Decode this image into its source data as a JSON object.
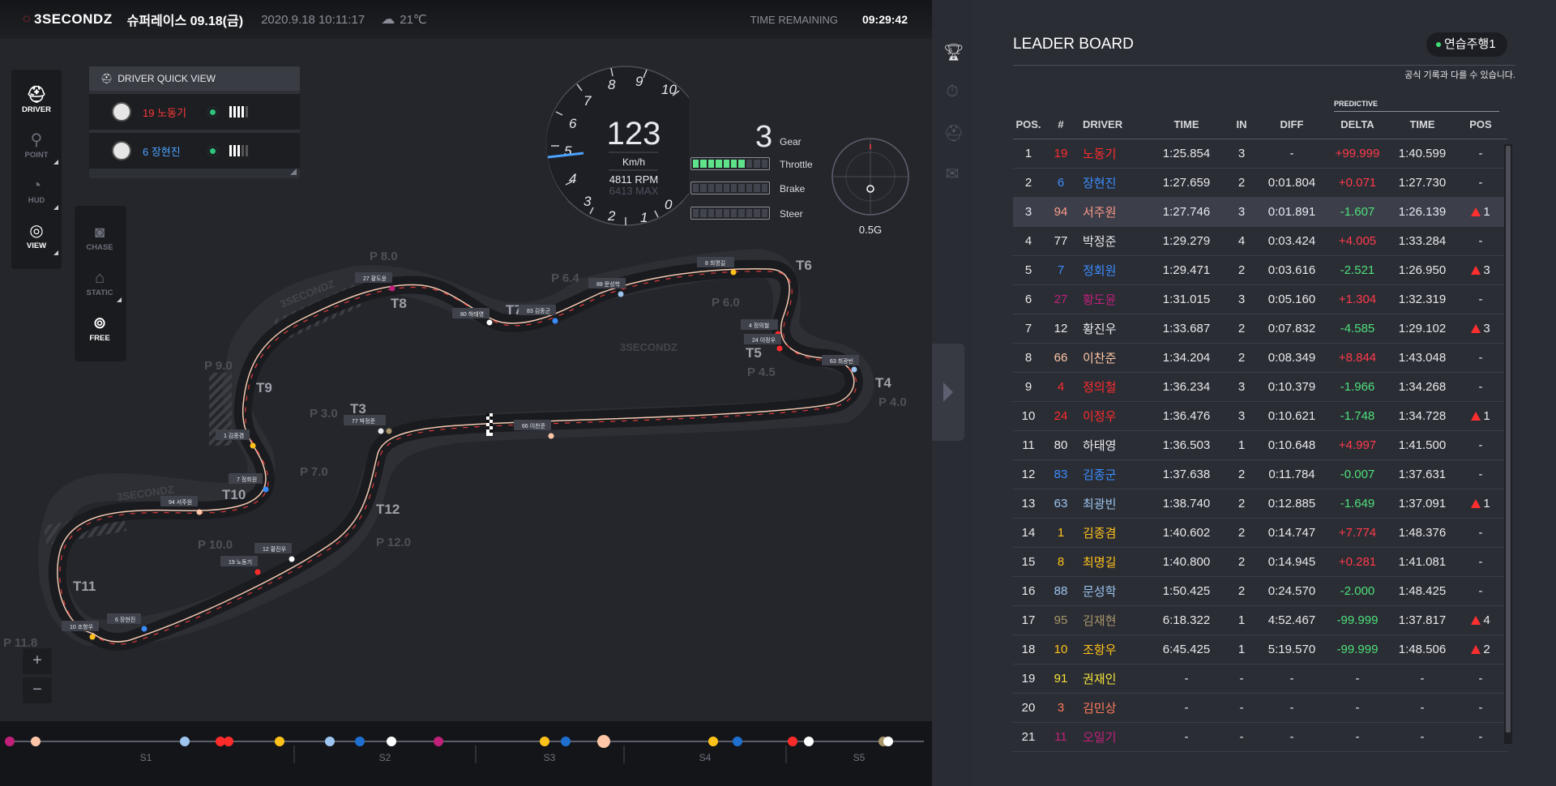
{
  "topbar": {
    "logo": "3SECONDZ",
    "race_title": "슈퍼레이스 09.18(금)",
    "datetime": "2020.9.18 10:11:17",
    "temperature": "21℃",
    "time_remaining_label": "TIME REMAINING",
    "time_remaining_value": "09:29:42"
  },
  "tools_left": [
    {
      "label": "DRIVER",
      "icon": "helmet-icon",
      "active": true
    },
    {
      "label": "POINT",
      "icon": "point-icon",
      "active": false
    },
    {
      "label": "HUD",
      "icon": "gauge-icon",
      "active": false
    },
    {
      "label": "VIEW",
      "icon": "target-icon",
      "active": true
    }
  ],
  "tools_camera": [
    {
      "label": "CHASE",
      "icon": "camera-icon"
    },
    {
      "label": "STATIC",
      "icon": "cctv-icon"
    },
    {
      "label": "FREE",
      "icon": "free-cam-icon"
    }
  ],
  "quick_view": {
    "title": "DRIVER QUICK VIEW",
    "drivers": [
      {
        "name": "19 노동기",
        "color": "#ff3a3a",
        "signal": 4
      },
      {
        "name": "6 장현진",
        "color": "#4aa3ff",
        "signal": 3
      }
    ]
  },
  "telemetry": {
    "speed": "123",
    "speed_unit": "Km/h",
    "rpm": "4811 RPM",
    "rpm_max": "6413 MAX",
    "gear": "3",
    "gear_label": "Gear",
    "throttle_label": "Throttle",
    "throttle_level": 0.7,
    "brake_label": "Brake",
    "brake_level": 0,
    "steer_label": "Steer",
    "steer_level": 0,
    "g_force": "0.5G",
    "gauge_ticks": [
      "0",
      "1",
      "2",
      "3",
      "4",
      "5",
      "6",
      "7",
      "8",
      "9",
      "10"
    ]
  },
  "track": {
    "watermark": "3SECONDZ",
    "turns": [
      "T8",
      "T7",
      "T6",
      "T5",
      "T4",
      "T9",
      "T3",
      "T10",
      "T12",
      "T11"
    ],
    "points": [
      "P 8.0",
      "P 6.4",
      "P 6.0",
      "P 4.5",
      "P 4.0",
      "P 9.0",
      "P 3.0",
      "P 7.0",
      "P 10.0",
      "P 12.0",
      "P 11.8"
    ],
    "car_labels": [
      "27 황도윤",
      "80 하태영",
      "83 김종군",
      "88 문성학",
      "8 최명길",
      "4 정의철",
      "24 이정우",
      "63 최광빈",
      "77 박정준",
      "66 이찬준",
      "1 김종겸",
      "7 정회원",
      "94 서주원",
      "12 황진우",
      "19 노동기",
      "10 조항우",
      "6 장현진"
    ]
  },
  "zoom": {
    "in": "+",
    "out": "−"
  },
  "timeline": {
    "sectors": [
      "S1",
      "S2",
      "S3",
      "S4",
      "S5"
    ]
  },
  "side_icons": [
    "trophy-icon",
    "stopwatch-icon",
    "helmet-icon",
    "chat-icon"
  ],
  "leaderboard": {
    "title": "LEADER BOARD",
    "session": "연습주행1",
    "note": "공식 기록과 다를 수 있습니다.",
    "predictive_label": "PREDICTIVE",
    "columns": [
      "POS.",
      "#",
      "DRIVER",
      "TIME",
      "IN",
      "DIFF",
      "DELTA",
      "TIME",
      "POS"
    ],
    "rows": [
      {
        "pos": "1",
        "num": "19",
        "driver": "노동기",
        "time": "1:25.854",
        "in": "3",
        "diff": "-",
        "delta": "+99.999",
        "ptime": "1:40.599",
        "pchange": "-",
        "color": "#ff2b2b"
      },
      {
        "pos": "2",
        "num": "6",
        "driver": "장현진",
        "time": "1:27.659",
        "in": "2",
        "diff": "0:01.804",
        "delta": "+0.071",
        "ptime": "1:27.730",
        "pchange": "-",
        "color": "#3a8dff"
      },
      {
        "pos": "3",
        "num": "94",
        "driver": "서주원",
        "time": "1:27.746",
        "in": "3",
        "diff": "0:01.891",
        "delta": "-1.607",
        "ptime": "1:26.139",
        "pchange": "1",
        "color": "#ff9a8a"
      },
      {
        "pos": "4",
        "num": "77",
        "driver": "박정준",
        "time": "1:29.279",
        "in": "4",
        "diff": "0:03.424",
        "delta": "+4.005",
        "ptime": "1:33.284",
        "pchange": "-",
        "color": "#e8e9ee"
      },
      {
        "pos": "5",
        "num": "7",
        "driver": "정회원",
        "time": "1:29.471",
        "in": "2",
        "diff": "0:03.616",
        "delta": "-2.521",
        "ptime": "1:26.950",
        "pchange": "3",
        "color": "#3a8dff"
      },
      {
        "pos": "6",
        "num": "27",
        "driver": "황도윤",
        "time": "1:31.015",
        "in": "3",
        "diff": "0:05.160",
        "delta": "+1.304",
        "ptime": "1:32.319",
        "pchange": "-",
        "color": "#c0207a"
      },
      {
        "pos": "7",
        "num": "12",
        "driver": "황진우",
        "time": "1:33.687",
        "in": "2",
        "diff": "0:07.832",
        "delta": "-4.585",
        "ptime": "1:29.102",
        "pchange": "3",
        "color": "#e8e9ee"
      },
      {
        "pos": "8",
        "num": "66",
        "driver": "이찬준",
        "time": "1:34.204",
        "in": "2",
        "diff": "0:08.349",
        "delta": "+8.844",
        "ptime": "1:43.048",
        "pchange": "-",
        "color": "#ffc7a8"
      },
      {
        "pos": "9",
        "num": "4",
        "driver": "정의철",
        "time": "1:36.234",
        "in": "3",
        "diff": "0:10.379",
        "delta": "-1.966",
        "ptime": "1:34.268",
        "pchange": "-",
        "color": "#ff2b2b"
      },
      {
        "pos": "10",
        "num": "24",
        "driver": "이정우",
        "time": "1:36.476",
        "in": "3",
        "diff": "0:10.621",
        "delta": "-1.748",
        "ptime": "1:34.728",
        "pchange": "1",
        "color": "#ff2b2b"
      },
      {
        "pos": "11",
        "num": "80",
        "driver": "하태영",
        "time": "1:36.503",
        "in": "1",
        "diff": "0:10.648",
        "delta": "+4.997",
        "ptime": "1:41.500",
        "pchange": "-",
        "color": "#e8e9ee"
      },
      {
        "pos": "12",
        "num": "83",
        "driver": "김종군",
        "time": "1:37.638",
        "in": "2",
        "diff": "0:11.784",
        "delta": "-0.007",
        "ptime": "1:37.631",
        "pchange": "-",
        "color": "#3a8dff"
      },
      {
        "pos": "13",
        "num": "63",
        "driver": "최광빈",
        "time": "1:38.740",
        "in": "2",
        "diff": "0:12.885",
        "delta": "-1.649",
        "ptime": "1:37.091",
        "pchange": "1",
        "color": "#9cc6f0"
      },
      {
        "pos": "14",
        "num": "1",
        "driver": "김종겸",
        "time": "1:40.602",
        "in": "2",
        "diff": "0:14.747",
        "delta": "+7.774",
        "ptime": "1:48.376",
        "pchange": "-",
        "color": "#ffc21a"
      },
      {
        "pos": "15",
        "num": "8",
        "driver": "최명길",
        "time": "1:40.800",
        "in": "2",
        "diff": "0:14.945",
        "delta": "+0.281",
        "ptime": "1:41.081",
        "pchange": "-",
        "color": "#ffc21a"
      },
      {
        "pos": "16",
        "num": "88",
        "driver": "문성학",
        "time": "1:50.425",
        "in": "2",
        "diff": "0:24.570",
        "delta": "-2.000",
        "ptime": "1:48.425",
        "pchange": "-",
        "color": "#9cc6f0"
      },
      {
        "pos": "17",
        "num": "95",
        "driver": "김재현",
        "time": "6:18.322",
        "in": "1",
        "diff": "4:52.467",
        "delta": "-99.999",
        "ptime": "1:37.817",
        "pchange": "4",
        "color": "#a8956a"
      },
      {
        "pos": "18",
        "num": "10",
        "driver": "조항우",
        "time": "6:45.425",
        "in": "1",
        "diff": "5:19.570",
        "delta": "-99.999",
        "ptime": "1:48.506",
        "pchange": "2",
        "color": "#ffc21a"
      },
      {
        "pos": "19",
        "num": "91",
        "driver": "권재인",
        "time": "-",
        "in": "-",
        "diff": "-",
        "delta": "-",
        "ptime": "-",
        "pchange": "-",
        "color": "#f3e33a"
      },
      {
        "pos": "20",
        "num": "3",
        "driver": "김민상",
        "time": "-",
        "in": "-",
        "diff": "-",
        "delta": "-",
        "ptime": "-",
        "pchange": "-",
        "color": "#ff7a5a"
      },
      {
        "pos": "21",
        "num": "11",
        "driver": "오일기",
        "time": "-",
        "in": "-",
        "diff": "-",
        "delta": "-",
        "ptime": "-",
        "pchange": "-",
        "color": "#c0207a"
      }
    ]
  },
  "colors": {
    "accent": "#e8323c",
    "positive_delta": "#ff3a4a",
    "negative_delta": "#4ee07a",
    "throttle": "#5ee38a"
  }
}
